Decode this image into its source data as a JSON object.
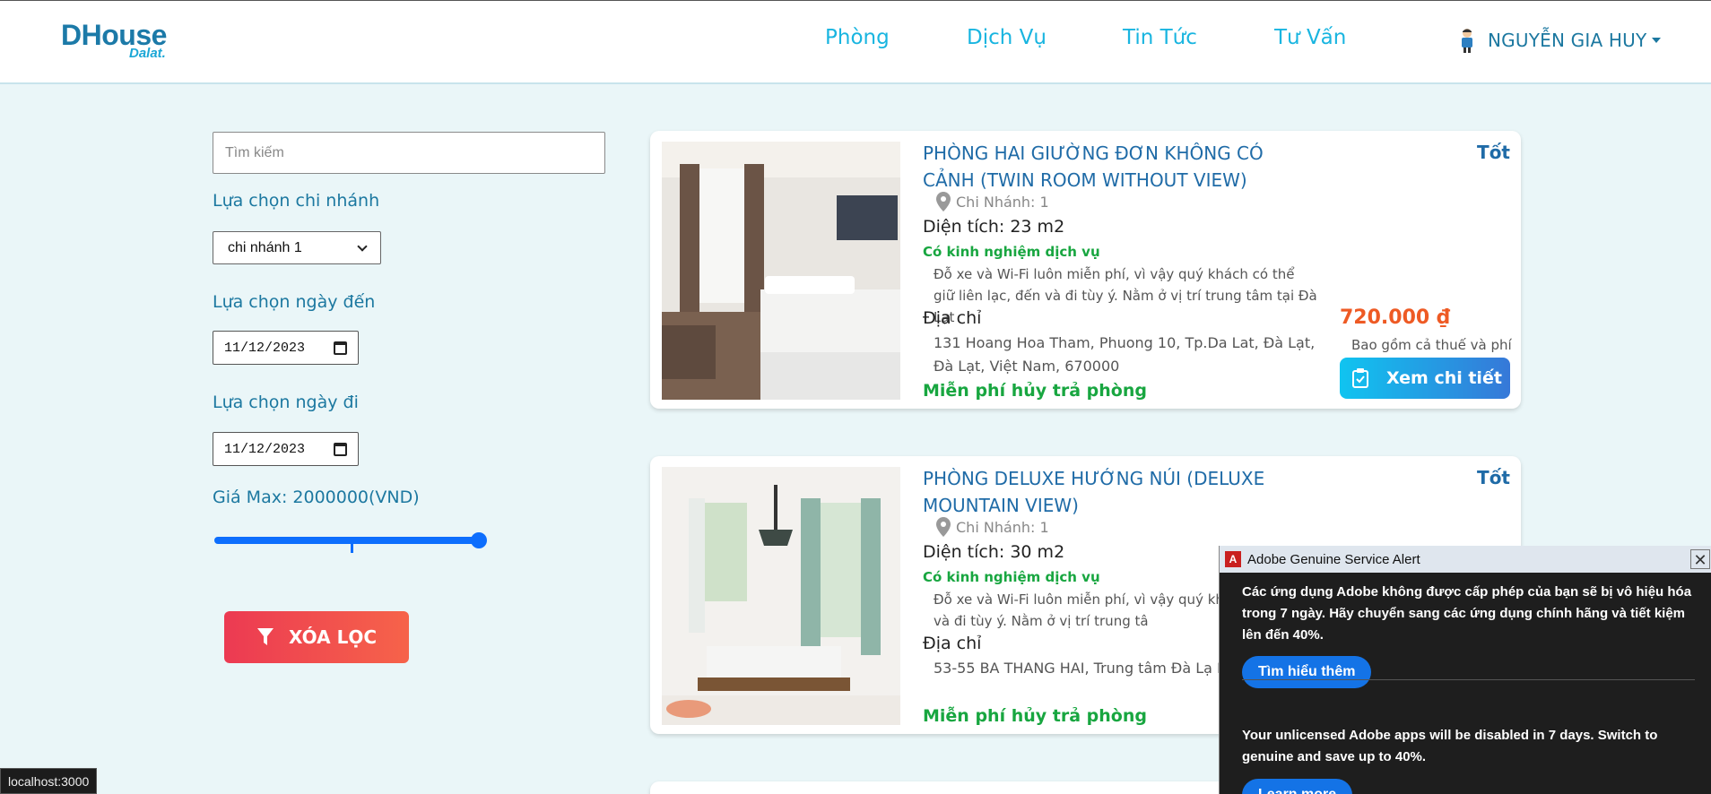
{
  "header": {
    "logo_main": "DHouse",
    "logo_sub": "Dalat.",
    "nav": [
      "Phòng",
      "Dịch Vụ",
      "Tin Tức",
      "Tư Vấn"
    ],
    "user_name": "NGUYỄN GIA HUY"
  },
  "sidebar": {
    "search_placeholder": "Tìm kiếm",
    "branch_label": "Lựa chọn chi nhánh",
    "branch_value": "chi nhánh 1",
    "arrive_label": "Lựa chọn ngày đến",
    "arrive_value": "11/12/2023",
    "depart_label": "Lựa chọn ngày đi",
    "depart_value": "11/12/2023",
    "price_label": "Giá Max: 2000000(VND)",
    "price_max": 2000000,
    "clear_label": "XÓA LỌC"
  },
  "rooms": [
    {
      "title": "PHÒNG HAI GIƯỜNG ĐƠN KHÔNG CÓ CẢNH (TWIN ROOM WITHOUT VIEW)",
      "rating": "Tốt",
      "branch": "Chi Nhánh: 1",
      "area": "Diện tích: 23 m2",
      "experience": "Có kinh nghiệm dịch vụ",
      "description": "Đỗ xe và Wi-Fi luôn miễn phí, vì vậy quý khách có thể giữ liên lạc, đến và đi tùy ý. Nằm ở vị trí trung tâm tại Đà Lạt",
      "address_label": "Địa chỉ",
      "address": "131 Hoang Hoa Tham, Phuong 10, Tp.Da Lat, Đà Lạt, Đà Lạt, Việt Nam, 670000",
      "free_cancel": "Miễn phí hủy trả phòng",
      "price": "720.000 ₫",
      "price_note": "Bao gồm cả thuế và phí",
      "detail_label": "Xem chi tiết"
    },
    {
      "title": "PHÒNG DELUXE HƯỚNG NÚI (DELUXE MOUNTAIN VIEW)",
      "rating": "Tốt",
      "branch": "Chi Nhánh: 1",
      "area": "Diện tích: 30 m2",
      "experience": "Có kinh nghiệm dịch vụ",
      "description": "Đỗ xe và Wi-Fi luôn miễn phí, vì vậy quý kh liên lạc, đến và đi tùy ý. Nằm ở vị trí trung tâ",
      "address_label": "Địa chỉ",
      "address": "53-55 BA THANG HAI, Trung tâm Đà Lạ Nam, 670000",
      "free_cancel": "Miễn phí hủy trả phòng"
    }
  ],
  "adobe_popup": {
    "title": "Adobe Genuine Service Alert",
    "message_vi": "Các ứng dụng Adobe không được cấp phép của bạn sẽ bị vô hiệu hóa trong 7 ngày. Hãy chuyển sang các ứng dụng chính hãng và tiết kiệm lên đến 40%.",
    "button_vi": "Tìm hiểu thêm",
    "message_en": "Your unlicensed Adobe apps will be disabled in 7 days. Switch to genuine and save up to 40%.",
    "button_en": "Learn more"
  },
  "status_bar": "localhost:3000",
  "colors": {
    "primary": "#1c78a0",
    "nav": "#19b5e0",
    "green": "#18a640",
    "price": "#ee5a24",
    "clear_btn": "#ec3a52",
    "slider": "#0d6efd"
  }
}
